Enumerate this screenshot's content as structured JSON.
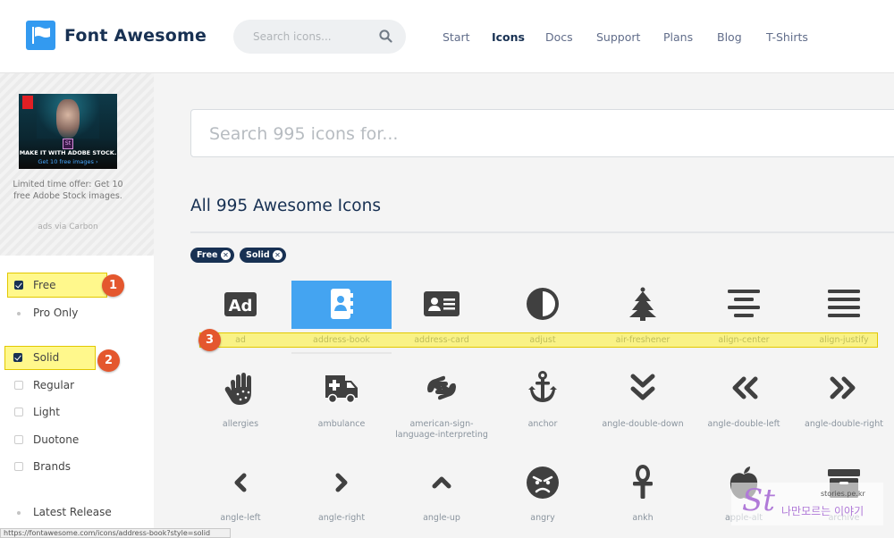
{
  "header": {
    "brand": "Font Awesome",
    "search_placeholder": "Search icons...",
    "nav": [
      "Start",
      "Icons",
      "Docs",
      "Support",
      "Plans",
      "Blog",
      "T-Shirts"
    ],
    "active_nav": "Icons"
  },
  "ad": {
    "headline": "MAKE IT WITH ADOBE STOCK.",
    "cta": "Get 10 free images ›",
    "logo_text": "St",
    "offer": "Limited time offer: Get 10 free Adobe Stock images.",
    "via": "ads via Carbon"
  },
  "filters": {
    "free": "Free",
    "pro_only": "Pro Only",
    "solid": "Solid",
    "regular": "Regular",
    "light": "Light",
    "duotone": "Duotone",
    "brands": "Brands",
    "latest_release": "Latest Release"
  },
  "annotations": [
    "1",
    "2",
    "3"
  ],
  "main": {
    "search_placeholder": "Search 995 icons for...",
    "heading": "All 995 Awesome Icons",
    "pills": [
      "Free",
      "Solid"
    ]
  },
  "icons": [
    "ad",
    "address-book",
    "address-card",
    "adjust",
    "air-freshener",
    "align-center",
    "align-justify",
    "allergies",
    "ambulance",
    "american-sign-language-interpreting",
    "anchor",
    "angle-double-down",
    "angle-double-left",
    "angle-double-right",
    "angle-left",
    "angle-right",
    "angle-up",
    "angry",
    "ankh",
    "apple-alt",
    "archive"
  ],
  "selected_icon": "address-book",
  "status_url": "https://fontawesome.com/icons/address-book?style=solid",
  "watermark": {
    "logo": "St",
    "url": "stories.pe.kr",
    "korean": "나만모르는 이야기"
  },
  "colors": {
    "brand_blue": "#339af0",
    "navy": "#183153",
    "selected_bg": "#44a4f1",
    "icon_gray": "#404040",
    "highlight": "#fff000",
    "badge": "#e4572e"
  }
}
